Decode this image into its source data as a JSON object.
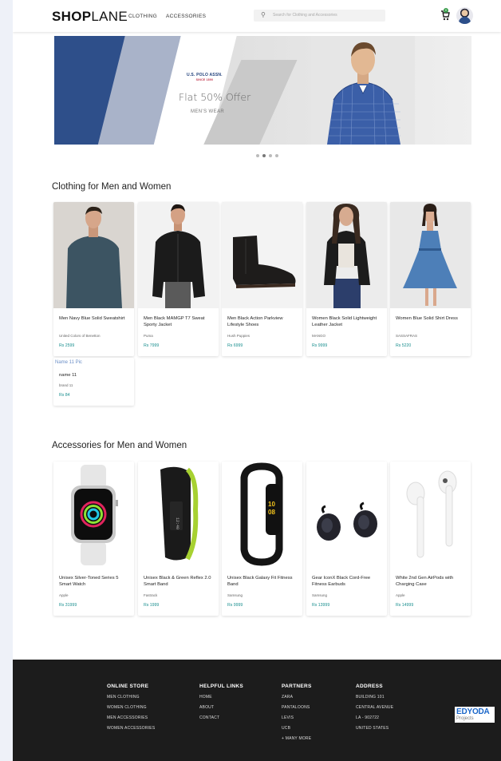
{
  "header": {
    "logo_bold": "SHOP",
    "logo_light": "LANE",
    "nav": [
      "CLOTHING",
      "ACCESSORIES"
    ],
    "search_placeholder": "Search for Clothing and Accessories",
    "cart_count": "0"
  },
  "banner": {
    "brand": "U.S. POLO ASSN.",
    "brand_sub": "SINCE 1890",
    "offer": "Flat 50% Offer",
    "offer_sub": "MEN'S WEAR",
    "slides": 4,
    "active_slide": 2
  },
  "clothing": {
    "title": "Clothing for Men and Women",
    "items": [
      {
        "name": "Men Navy Blue Solid Sweatshirt",
        "brand": "United Colors of Benetton",
        "price": "Rs 2599"
      },
      {
        "name": "Men Black MAMGP T7 Sweat Sporty Jacket",
        "brand": "Puma",
        "price": "Rs 7999"
      },
      {
        "name": "Men Black Action Parkview Lifestyle Shoes",
        "brand": "Hush Puppies",
        "price": "Rs 6999"
      },
      {
        "name": "Women Black Solid Lightweight Leather Jacket",
        "brand": "MANGO",
        "price": "Rs 9999"
      },
      {
        "name": "Women Blue Solid Shirt Dress",
        "brand": "SASSAFRAS",
        "price": "Rs 5220"
      }
    ],
    "extra": {
      "alt": "Name 11 Pic",
      "name": "name 11",
      "brand": "brand 11",
      "price": "Rs 84"
    }
  },
  "accessories": {
    "title": "Accessories for Men and Women",
    "items": [
      {
        "name": "Unisex Silver-Toned Series 5 Smart Watch",
        "brand": "Apple",
        "price": "Rs 31999"
      },
      {
        "name": "Unisex Black & Green Reflex 2.0 Smart Band",
        "brand": "Fastrack",
        "price": "Rs 1999"
      },
      {
        "name": "Unisex Black Galaxy Fit Fitness Band",
        "brand": "Samsung",
        "price": "Rs 9999"
      },
      {
        "name": "Gear IconX Black Cord-Free Fitness Earbuds",
        "brand": "Samsung",
        "price": "Rs 13999"
      },
      {
        "name": "White 2nd Gen AirPods with Charging Case",
        "brand": "Apple",
        "price": "Rs 14999"
      }
    ]
  },
  "footer": {
    "columns": [
      {
        "head": "ONLINE STORE",
        "items": [
          "MEN CLOTHING",
          "WOMEN CLOTHING",
          "MEN ACCESSORIES",
          "WOMEN ACCESSORIES"
        ]
      },
      {
        "head": "HELPFUL LINKS",
        "items": [
          "HOME",
          "ABOUT",
          "CONTACT"
        ]
      },
      {
        "head": "PARTNERS",
        "items": [
          "ZARA",
          "PANTALOONS",
          "LEVIS",
          "UCB",
          "+ MANY MORE"
        ]
      },
      {
        "head": "ADDRESS",
        "items": [
          "BUILDING 101",
          "CENTRAL AVENUE",
          "LA - 902722",
          "UNITED STATES"
        ]
      }
    ],
    "badge_title": "EDYODA",
    "badge_sub": "Projects"
  },
  "colors": {
    "price": "#1a8f8f",
    "banner_blue": "#2e4f8a",
    "footer_bg": "#1c1c1c"
  }
}
